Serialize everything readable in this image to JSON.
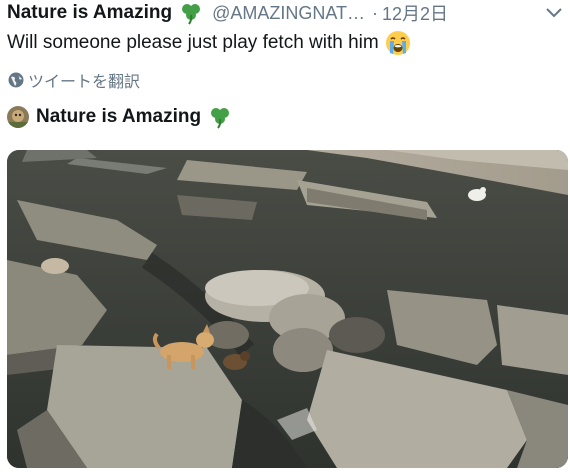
{
  "tweet": {
    "display_name": "Nature is Amazing",
    "name_emoji": "shamrock-icon",
    "handle": "@AMAZINGNAT…",
    "separator": "·",
    "date": "12月2日",
    "text": "Will someone please just play fetch with him",
    "text_emoji": "loudly-crying-face-icon",
    "translate_label": "ツイートを翻訳"
  },
  "embedded_card": {
    "display_name": "Nature is Amazing",
    "name_emoji": "shamrock-icon",
    "media": "video-thumbnail"
  },
  "colors": {
    "text_primary": "#14171a",
    "text_secondary": "#657786",
    "shamrock_green": "#43a047"
  }
}
